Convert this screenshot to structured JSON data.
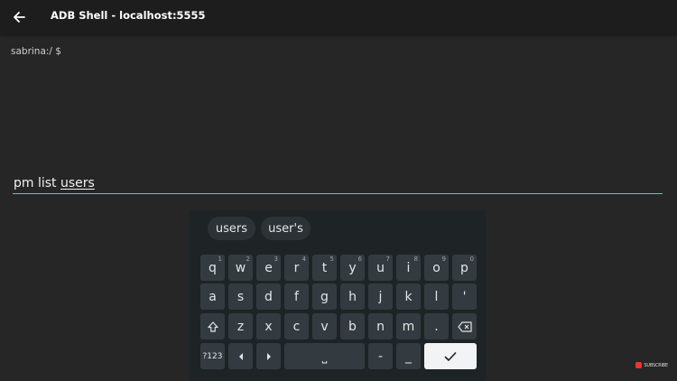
{
  "app": {
    "title": "ADB Shell - localhost:5555"
  },
  "terminal": {
    "prompt": "sabrina:/ $",
    "command_prefix": "pm list ",
    "command_word": "users"
  },
  "keyboard": {
    "suggestions": [
      "users",
      "user's"
    ],
    "row1": [
      {
        "label": "q",
        "hint": "1"
      },
      {
        "label": "w",
        "hint": "2"
      },
      {
        "label": "e",
        "hint": "3"
      },
      {
        "label": "r",
        "hint": "4"
      },
      {
        "label": "t",
        "hint": "5"
      },
      {
        "label": "y",
        "hint": "6"
      },
      {
        "label": "u",
        "hint": "7"
      },
      {
        "label": "i",
        "hint": "8"
      },
      {
        "label": "o",
        "hint": "9"
      },
      {
        "label": "p",
        "hint": "0"
      }
    ],
    "row2": [
      "a",
      "s",
      "d",
      "f",
      "g",
      "h",
      "j",
      "k",
      "l",
      "'"
    ],
    "row3": [
      "z",
      "x",
      "c",
      "v",
      "b",
      "n",
      "m",
      "."
    ],
    "symbols_label": "?123",
    "dash_label": "-",
    "underscore_label": "_",
    "space_symbol": "⎵"
  },
  "watermark": {
    "text": "SUBSCRIBE"
  }
}
